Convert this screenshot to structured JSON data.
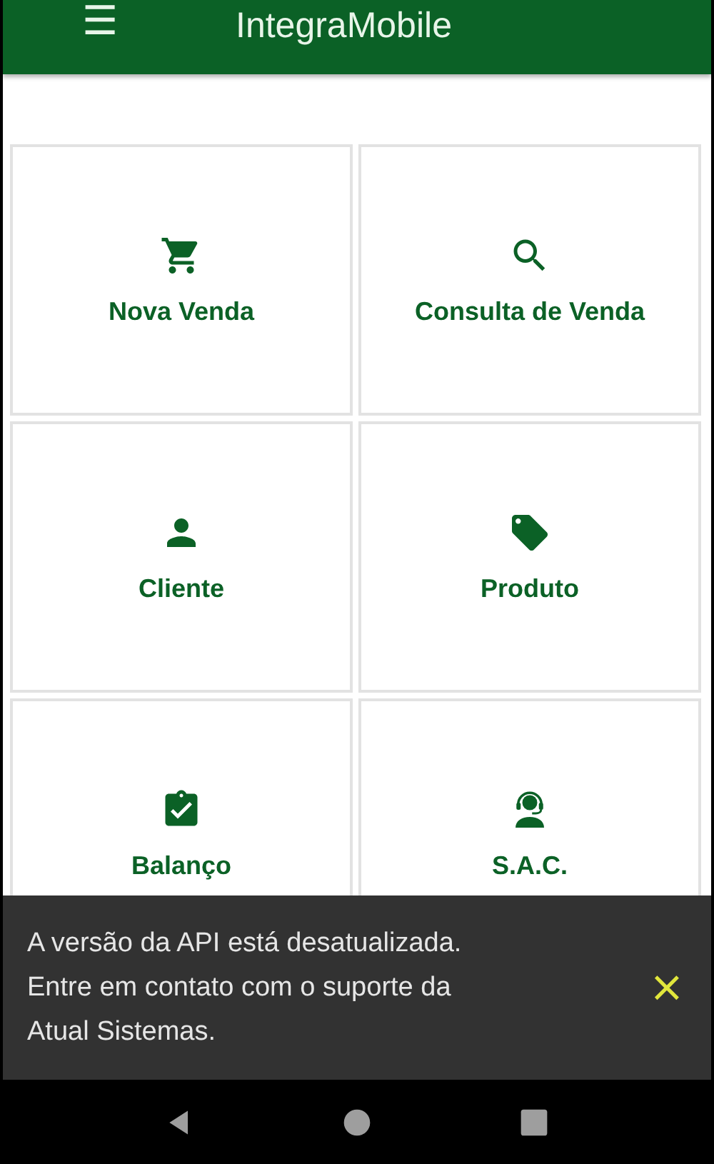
{
  "app_bar": {
    "menu_icon": "☰",
    "title": "IntegraMobile"
  },
  "tiles": [
    {
      "kind": "cart",
      "label": "Nova Venda"
    },
    {
      "kind": "search",
      "label": "Consulta de Venda"
    },
    {
      "kind": "person",
      "label": "Cliente"
    },
    {
      "kind": "tag",
      "label": "Produto"
    },
    {
      "kind": "clipboard",
      "label": "Balanço"
    },
    {
      "kind": "support",
      "label": "S.A.C."
    }
  ],
  "snackbar": {
    "message": "A versão da API está desatualizada. Entre em contato com o suporte da Atual Sistemas.",
    "close": "×"
  }
}
